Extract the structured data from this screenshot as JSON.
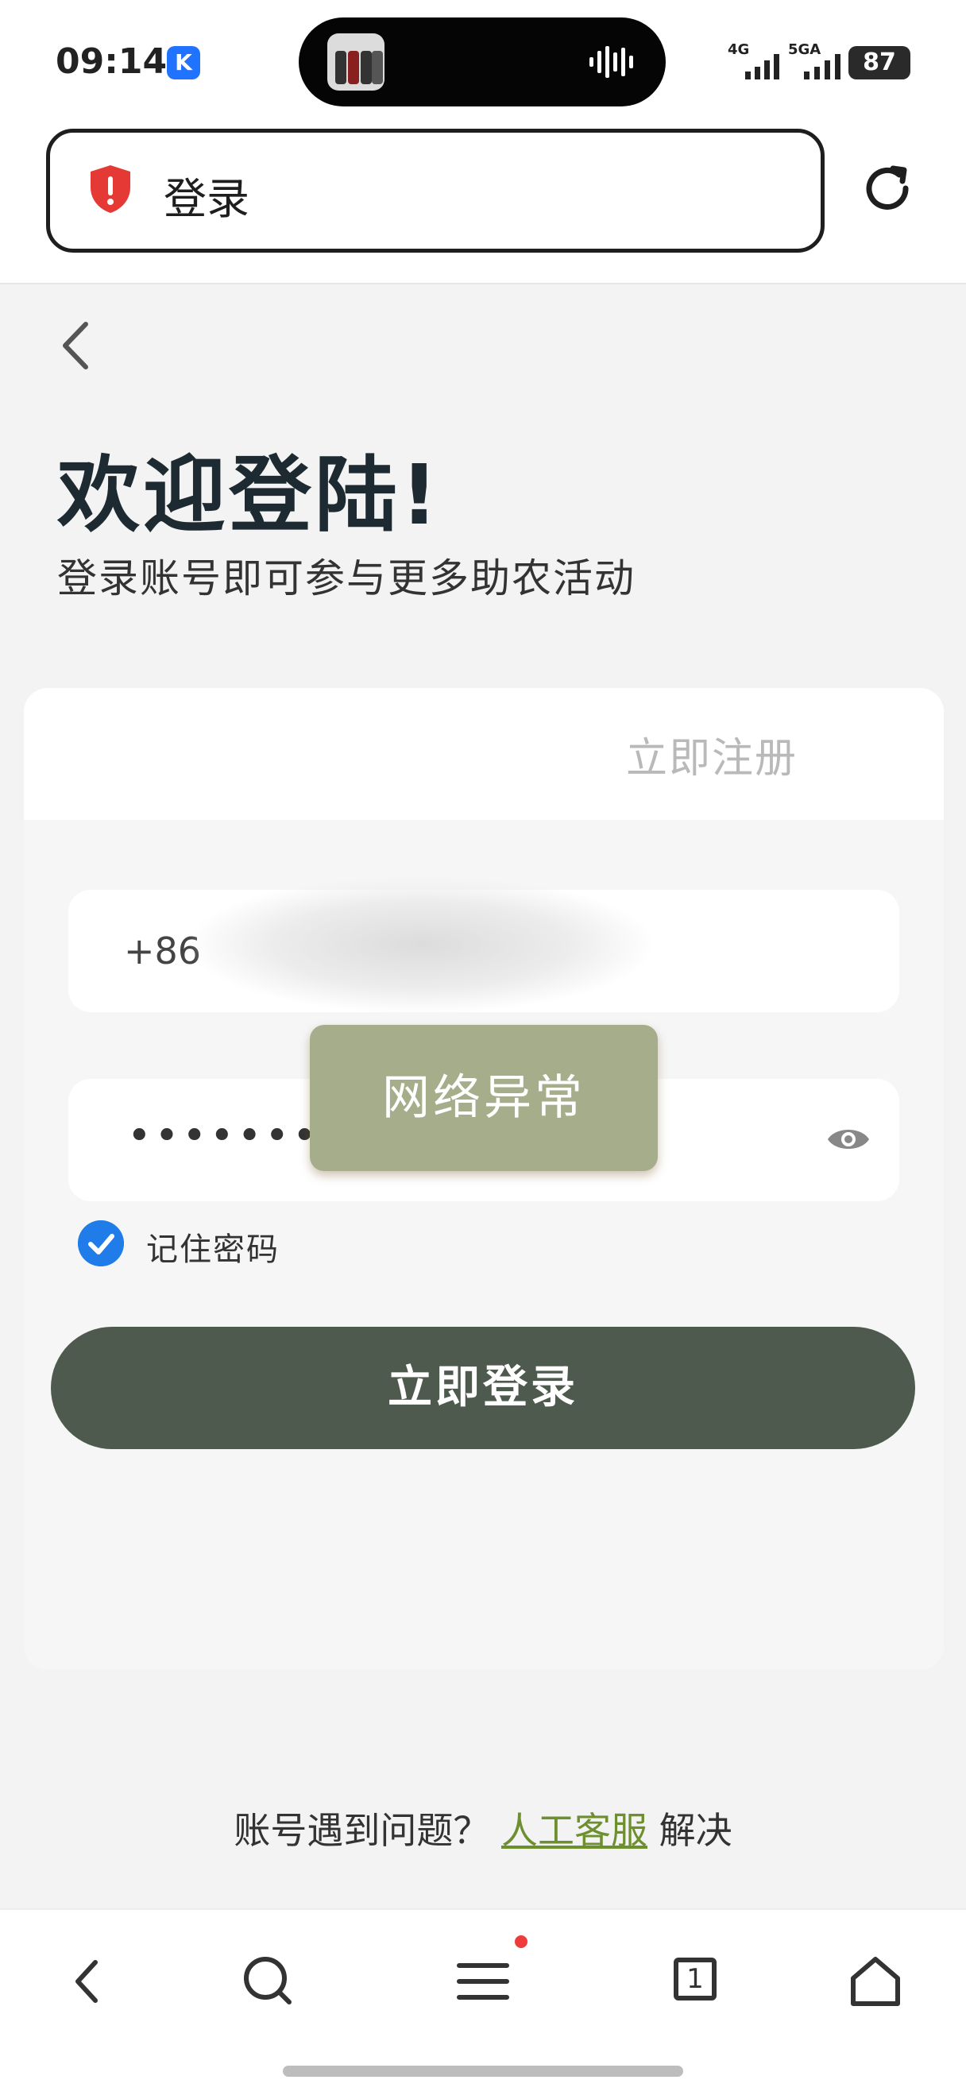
{
  "status_bar": {
    "time": "09:14",
    "app_badge": "K",
    "network_1": "4G",
    "network_2": "5GA",
    "battery": "87"
  },
  "browser": {
    "page_title": "登录",
    "security_icon_color": "#e53935"
  },
  "page": {
    "welcome": "欢迎登陆!",
    "subtitle": "登录账号即可参与更多助农活动",
    "register_link": "立即注册",
    "phone_prefix": "+86",
    "password_mask": "••••••••",
    "remember_label": "记住密码",
    "remember_checked": true,
    "login_button": "立即登录",
    "toast": "网络异常",
    "help_prefix": "账号遇到问题？",
    "help_link": "人工客服",
    "help_suffix": "解决"
  },
  "bottom_nav": {
    "tab_count": "1",
    "menu_has_notification": true
  },
  "colors": {
    "primary_button": "#4d5a4d",
    "toast_bg": "#a6ad8a",
    "link": "#6d8f2e",
    "check": "#1f7ce8"
  }
}
